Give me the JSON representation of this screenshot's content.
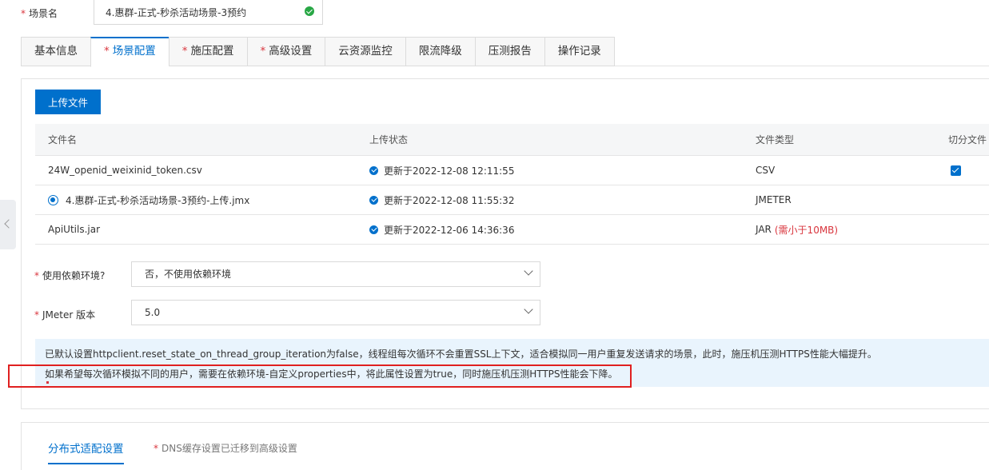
{
  "scene": {
    "label": "场景名",
    "value": "4.惠群-正式-秒杀活动场景-3预约"
  },
  "tabs": [
    {
      "label": "基本信息",
      "required": false,
      "active": false
    },
    {
      "label": "场景配置",
      "required": true,
      "active": true
    },
    {
      "label": "施压配置",
      "required": true,
      "active": false
    },
    {
      "label": "高级设置",
      "required": true,
      "active": false
    },
    {
      "label": "云资源监控",
      "required": false,
      "active": false
    },
    {
      "label": "限流降级",
      "required": false,
      "active": false
    },
    {
      "label": "压测报告",
      "required": false,
      "active": false
    },
    {
      "label": "操作记录",
      "required": false,
      "active": false
    }
  ],
  "upload_button": "上传文件",
  "file_table": {
    "headers": {
      "name": "文件名",
      "status": "上传状态",
      "type": "文件类型",
      "split": "切分文件"
    },
    "rows": [
      {
        "name": "24W_openid_weixinid_token.csv",
        "status": "更新于2022-12-08 12:11:55",
        "type": "CSV",
        "note": "",
        "selected": false,
        "split": true
      },
      {
        "name": "4.惠群-正式-秒杀活动场景-3预约-上传.jmx",
        "status": "更新于2022-12-08 11:55:32",
        "type": "JMETER",
        "note": "",
        "selected": true,
        "split": false
      },
      {
        "name": "ApiUtils.jar",
        "status": "更新于2022-12-06 14:36:36",
        "type": "JAR",
        "note": "(需小于10MB)",
        "selected": false,
        "split": false
      }
    ]
  },
  "form": {
    "dependency_env": {
      "label": "使用依赖环境?",
      "value": "否，不使用依赖环境"
    },
    "jmeter_version": {
      "label": "JMeter 版本",
      "value": "5.0"
    }
  },
  "notice": {
    "line1": "已默认设置httpclient.reset_state_on_thread_group_iteration为false，线程组每次循环不会重置SSL上下文，适合模拟同一用户重复发送请求的场景，此时，施压机压测HTTPS性能大幅提升。",
    "line2": "如果希望每次循环模拟不同的用户，需要在依赖环境-自定义properties中，将此属性设置为true，同时施压机压测HTTPS性能会下降。"
  },
  "bottom": {
    "tab_label": "分布式适配设置",
    "dns_note": "DNS缓存设置已迁移到高级设置"
  },
  "colors": {
    "primary": "#0070cc",
    "required": "#d9363e",
    "success": "#28a745",
    "notice_bg": "#e9f4fd",
    "highlight": "#e02020"
  },
  "icons": [
    "check-circle-icon",
    "chevron-down-icon",
    "collapse-left-icon"
  ]
}
